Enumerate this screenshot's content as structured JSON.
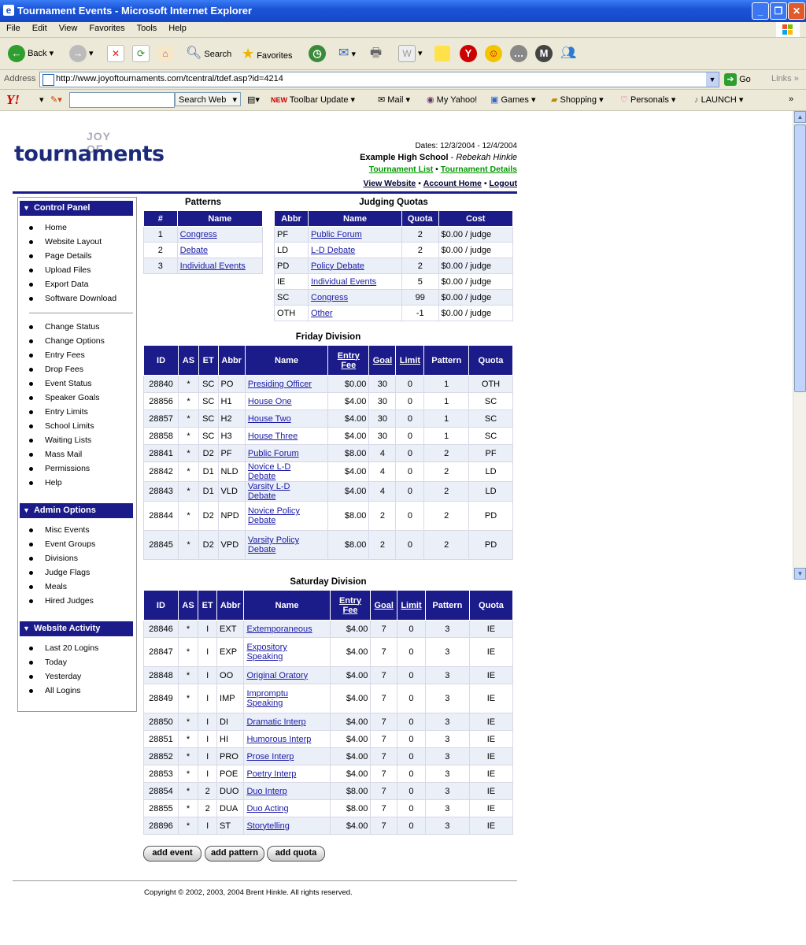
{
  "window": {
    "title": "Tournament Events - Microsoft Internet Explorer"
  },
  "menu": [
    "File",
    "Edit",
    "View",
    "Favorites",
    "Tools",
    "Help"
  ],
  "toolbar": {
    "back": "Back",
    "search": "Search",
    "favorites": "Favorites"
  },
  "address": {
    "label": "Address",
    "url": "http://www.joyoftournaments.com/tcentral/tdef.asp?id=4214",
    "go": "Go",
    "links": "Links"
  },
  "yahoo": {
    "search_button": "Search Web",
    "items": [
      "Toolbar Update",
      "Mail",
      "My Yahoo!",
      "Games",
      "Shopping",
      "Personals",
      "LAUNCH"
    ],
    "new_badge": "NEW"
  },
  "logo": {
    "joy": "JOY OF",
    "tournaments": "tournaments"
  },
  "header": {
    "dates_label": "Dates:",
    "dates": "12/3/2004 - 12/4/2004",
    "school": "Example High School",
    "dash": " - ",
    "person": "Rebekah Hinkle",
    "tournament_list": "Tournament List",
    "tournament_details": "Tournament Details",
    "view_website": "View Website",
    "account_home": "Account Home",
    "logout": "Logout",
    "dot": "•"
  },
  "sidebar": {
    "control_panel": {
      "title": "Control Panel",
      "group1": [
        "Home",
        "Website Layout",
        "Page Details",
        "Upload Files",
        "Export Data",
        "Software Download"
      ],
      "group2": [
        "Change Status",
        "Change Options",
        "Entry Fees",
        "Drop Fees",
        "Event Status",
        "Speaker Goals",
        "Entry Limits",
        "School Limits",
        "Waiting Lists",
        "Mass Mail",
        "Permissions",
        "Help"
      ]
    },
    "admin_options": {
      "title": "Admin Options",
      "items": [
        "Misc Events",
        "Event Groups",
        "Divisions",
        "Judge Flags",
        "Meals",
        "Hired Judges"
      ]
    },
    "website_activity": {
      "title": "Website Activity",
      "items": [
        "Last 20 Logins",
        "Today",
        "Yesterday",
        "All Logins"
      ]
    }
  },
  "patterns": {
    "title": "Patterns",
    "headers": [
      "#",
      "Name"
    ],
    "rows": [
      [
        "1",
        "Congress"
      ],
      [
        "2",
        "Debate"
      ],
      [
        "3",
        "Individual Events"
      ]
    ]
  },
  "judging": {
    "title": "Judging Quotas",
    "headers": [
      "Abbr",
      "Name",
      "Quota",
      "Cost"
    ],
    "rows": [
      [
        "PF",
        "Public Forum",
        "2",
        "$0.00 / judge"
      ],
      [
        "LD",
        "L-D Debate",
        "2",
        "$0.00 / judge"
      ],
      [
        "PD",
        "Policy Debate",
        "2",
        "$0.00 / judge"
      ],
      [
        "IE",
        "Individual Events",
        "5",
        "$0.00 / judge"
      ],
      [
        "SC",
        "Congress",
        "99",
        "$0.00 / judge"
      ],
      [
        "OTH",
        "Other",
        "-1",
        "$0.00 / judge"
      ]
    ]
  },
  "friday": {
    "title": "Friday Division",
    "headers": [
      "ID",
      "AS",
      "ET",
      "Abbr",
      "Name",
      "Entry Fee",
      "Goal",
      "Limit",
      "Pattern",
      "Quota"
    ],
    "rows": [
      [
        "28840",
        "*",
        "SC",
        "PO",
        "Presiding Officer",
        "$0.00",
        "30",
        "0",
        "1",
        "OTH"
      ],
      [
        "28856",
        "*",
        "SC",
        "H1",
        "House One",
        "$4.00",
        "30",
        "0",
        "1",
        "SC"
      ],
      [
        "28857",
        "*",
        "SC",
        "H2",
        "House Two",
        "$4.00",
        "30",
        "0",
        "1",
        "SC"
      ],
      [
        "28858",
        "*",
        "SC",
        "H3",
        "House Three",
        "$4.00",
        "30",
        "0",
        "1",
        "SC"
      ],
      [
        "28841",
        "*",
        "D2",
        "PF",
        "Public Forum",
        "$8.00",
        "4",
        "0",
        "2",
        "PF"
      ],
      [
        "28842",
        "*",
        "D1",
        "NLD",
        "Novice L-D Debate",
        "$4.00",
        "4",
        "0",
        "2",
        "LD"
      ],
      [
        "28843",
        "*",
        "D1",
        "VLD",
        "Varsity L-D Debate",
        "$4.00",
        "4",
        "0",
        "2",
        "LD"
      ],
      [
        "28844",
        "*",
        "D2",
        "NPD",
        "Novice Policy Debate",
        "$8.00",
        "2",
        "0",
        "2",
        "PD"
      ],
      [
        "28845",
        "*",
        "D2",
        "VPD",
        "Varsity Policy Debate",
        "$8.00",
        "2",
        "0",
        "2",
        "PD"
      ]
    ]
  },
  "saturday": {
    "title": "Saturday Division",
    "headers": [
      "ID",
      "AS",
      "ET",
      "Abbr",
      "Name",
      "Entry Fee",
      "Goal",
      "Limit",
      "Pattern",
      "Quota"
    ],
    "rows": [
      [
        "28846",
        "*",
        "I",
        "EXT",
        "Extemporaneous",
        "$4.00",
        "7",
        "0",
        "3",
        "IE"
      ],
      [
        "28847",
        "*",
        "I",
        "EXP",
        "Expository Speaking",
        "$4.00",
        "7",
        "0",
        "3",
        "IE"
      ],
      [
        "28848",
        "*",
        "I",
        "OO",
        "Original Oratory",
        "$4.00",
        "7",
        "0",
        "3",
        "IE"
      ],
      [
        "28849",
        "*",
        "I",
        "IMP",
        "Impromptu Speaking",
        "$4.00",
        "7",
        "0",
        "3",
        "IE"
      ],
      [
        "28850",
        "*",
        "I",
        "DI",
        "Dramatic Interp",
        "$4.00",
        "7",
        "0",
        "3",
        "IE"
      ],
      [
        "28851",
        "*",
        "I",
        "HI",
        "Humorous Interp",
        "$4.00",
        "7",
        "0",
        "3",
        "IE"
      ],
      [
        "28852",
        "*",
        "I",
        "PRO",
        "Prose Interp",
        "$4.00",
        "7",
        "0",
        "3",
        "IE"
      ],
      [
        "28853",
        "*",
        "I",
        "POE",
        "Poetry Interp",
        "$4.00",
        "7",
        "0",
        "3",
        "IE"
      ],
      [
        "28854",
        "*",
        "2",
        "DUO",
        "Duo Interp",
        "$8.00",
        "7",
        "0",
        "3",
        "IE"
      ],
      [
        "28855",
        "*",
        "2",
        "DUA",
        "Duo Acting",
        "$8.00",
        "7",
        "0",
        "3",
        "IE"
      ],
      [
        "28896",
        "*",
        "I",
        "ST",
        "Storytelling",
        "$4.00",
        "7",
        "0",
        "3",
        "IE"
      ]
    ]
  },
  "buttons": {
    "add_event": "add event",
    "add_pattern": "add pattern",
    "add_quota": "add quota"
  },
  "footer": {
    "copyright": "Copyright © 2002, 2003, 2004 Brent Hinkle. All rights reserved."
  }
}
